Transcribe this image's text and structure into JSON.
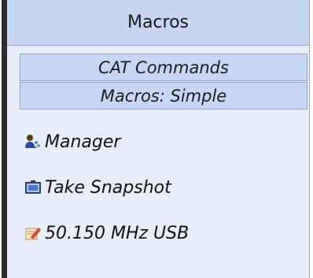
{
  "panel": {
    "title": "Macros"
  },
  "sections": [
    {
      "label": "CAT Commands"
    },
    {
      "label": "Macros: Simple"
    }
  ],
  "items": [
    {
      "label": "Manager",
      "icon": "manager-people-icon"
    },
    {
      "label": "Take Snapshot",
      "icon": "snapshot-camera-icon"
    },
    {
      "label": "50.150 MHz USB",
      "icon": "memo-pencil-icon"
    }
  ],
  "colors": {
    "panel_bg": "#e7eef9",
    "header_bg": "#c6d6f1",
    "tab_bg": "#c7d7f3",
    "border": "#8ea7d6"
  }
}
